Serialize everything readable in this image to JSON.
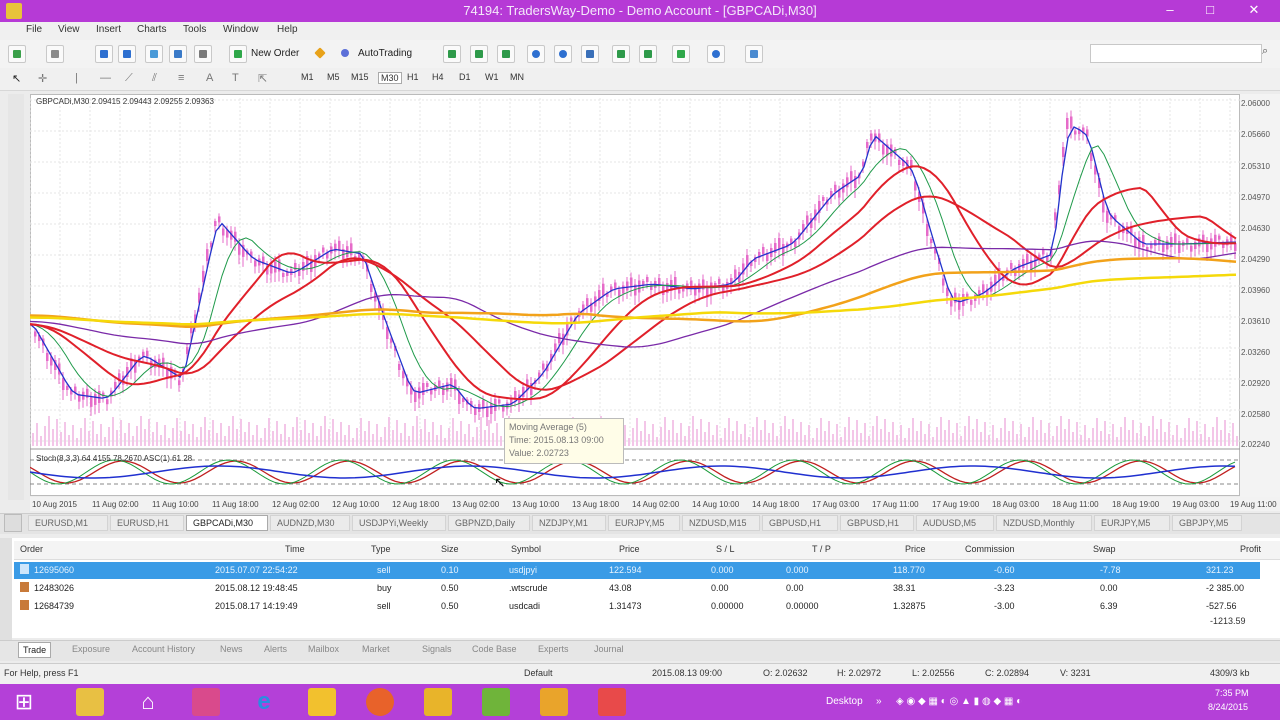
{
  "window": {
    "title": "74194: TradersWay-Demo - Demo Account - [GBPCADi,M30]"
  },
  "menu": [
    "File",
    "View",
    "Insert",
    "Charts",
    "Tools",
    "Window",
    "Help"
  ],
  "toolbar": {
    "new_order": "New Order",
    "auto_trading": "AutoTrading"
  },
  "timeframes": [
    "M1",
    "M5",
    "M15",
    "M30",
    "H1",
    "H4",
    "D1",
    "W1",
    "MN"
  ],
  "chart": {
    "header": "GBPCADi,M30  2.09415 2.09443 2.09255 2.09363",
    "stoch_header": "Stoch(8,3,3) 64.4155 78.2670 ASC(1) 61.28",
    "tooltip": {
      "line1": "Moving Average (5)",
      "line2": "Time: 2015.08.13 09:00",
      "line3": "Value: 2.02723"
    },
    "price_labels": [
      "2.06000",
      "2.05660",
      "2.05310",
      "2.04970",
      "2.04630",
      "2.04290",
      "2.03960",
      "2.03610",
      "2.03260",
      "2.02920",
      "2.02580",
      "2.02240"
    ],
    "time_labels": [
      "10 Aug 2015",
      "11 Aug 02:00",
      "11 Aug 10:00",
      "11 Aug 18:00",
      "12 Aug 02:00",
      "12 Aug 10:00",
      "12 Aug 18:00",
      "13 Aug 02:00",
      "13 Aug 10:00",
      "13 Aug 18:00",
      "14 Aug 02:00",
      "14 Aug 10:00",
      "14 Aug 18:00",
      "17 Aug 03:00",
      "17 Aug 11:00",
      "17 Aug 19:00",
      "18 Aug 03:00",
      "18 Aug 11:00",
      "18 Aug 19:00",
      "19 Aug 03:00",
      "19 Aug 11:00"
    ]
  },
  "chart_tabs": [
    "EURUSD,M1",
    "EURUSD,H1",
    "GBPCADi,M30",
    "AUDNZD,M30",
    "USDJPYi,Weekly",
    "GBPNZD,Daily",
    "NZDJPY,M1",
    "EURJPY,M5",
    "NZDUSD,M15",
    "GBPUSD,H1",
    "GBPUSD,H1",
    "AUDUSD,M5",
    "NZDUSD,Monthly",
    "EURJPY,M5",
    "GBPJPY,M5"
  ],
  "orders": {
    "columns": [
      "Order",
      "Time",
      "Type",
      "Size",
      "Symbol",
      "Price",
      "S / L",
      "T / P",
      "Price",
      "Commission",
      "Swap",
      "Profit"
    ],
    "rows": [
      {
        "order": "12695060",
        "time": "2015.07.07 22:54:22",
        "type": "sell",
        "size": "0.10",
        "symbol": "usdjpyi",
        "price": "122.594",
        "sl": "0.000",
        "tp": "0.000",
        "cur": "118.770",
        "commission": "-0.60",
        "swap": "-7.78",
        "profit": "321.23"
      },
      {
        "order": "12483026",
        "time": "2015.08.12 19:48:45",
        "type": "buy",
        "size": "0.50",
        "symbol": ".wtscrude",
        "price": "43.08",
        "sl": "0.00",
        "tp": "0.00",
        "cur": "38.31",
        "commission": "-3.23",
        "swap": "0.00",
        "profit": "-2 385.00"
      },
      {
        "order": "12684739",
        "time": "2015.08.17 14:19:49",
        "type": "sell",
        "size": "0.50",
        "symbol": "usdcadi",
        "price": "1.31473",
        "sl": "0.00000",
        "tp": "0.00000",
        "cur": "1.32875",
        "commission": "-3.00",
        "swap": "6.39",
        "profit": "-527.56"
      }
    ],
    "extra_profit": "-1213.59"
  },
  "terminal_tabs": [
    "Trade",
    "Exposure",
    "Account History",
    "News",
    "Alerts",
    "Mailbox",
    "Market",
    "Signals",
    "Code Base",
    "Experts",
    "Journal"
  ],
  "status": {
    "help": "For Help, press F1",
    "profile": "Default",
    "datetime": "2015.08.13 09:00",
    "open": "O: 2.02632",
    "high": "H: 2.02972",
    "low": "L: 2.02556",
    "close": "C: 2.02894",
    "volume": "V: 3231",
    "traffic": "4309/3 kb"
  },
  "taskbar": {
    "desktop": "Desktop",
    "time": "7:35 PM",
    "date": "8/24/2015"
  },
  "colors": {
    "title_bar": "#b63ad6",
    "selection": "#3a9be6",
    "ma_yellow": "#f5d90a",
    "ma_orange": "#f2a21a",
    "ma_red": "#e0202a",
    "ma_blue": "#2233cc",
    "ma_green": "#1f9a4a",
    "ma_purple": "#7a2aa8",
    "candle": "#e66bc9"
  }
}
